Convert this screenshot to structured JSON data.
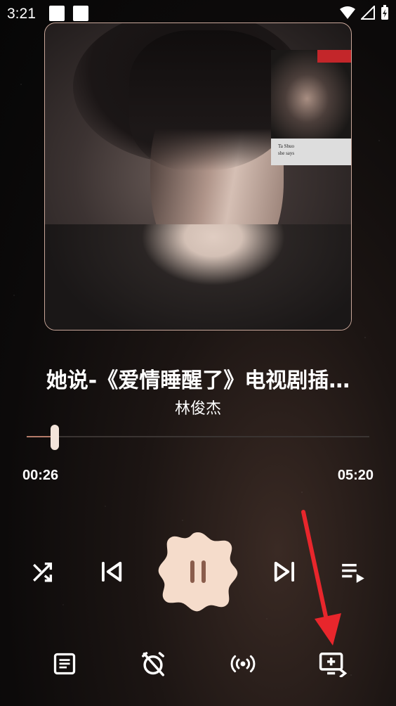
{
  "status_bar": {
    "time": "3:21"
  },
  "album": {
    "inset_caption_line1": "Ta Shuo",
    "inset_caption_line2": "she says"
  },
  "song": {
    "title": "她说-《爱情睡醒了》电视剧插…",
    "artist": "林俊杰"
  },
  "progress": {
    "current": "00:26",
    "total": "05:20",
    "fraction": 0.08125
  },
  "controls": [
    {
      "name": "shuffle-button",
      "icon": "shuffle-icon"
    },
    {
      "name": "previous-button",
      "icon": "skip-previous-icon"
    },
    {
      "name": "pause-button",
      "icon": "pause-icon"
    },
    {
      "name": "next-button",
      "icon": "skip-next-icon"
    },
    {
      "name": "playlist-button",
      "icon": "queue-music-icon"
    }
  ],
  "bottom_actions": [
    {
      "name": "lyrics-button",
      "icon": "lyrics-icon"
    },
    {
      "name": "sleep-timer-button",
      "icon": "alarm-off-icon"
    },
    {
      "name": "broadcast-button",
      "icon": "broadcast-icon"
    },
    {
      "name": "add-to-playlist-button",
      "icon": "add-to-queue-icon"
    }
  ],
  "colors": {
    "accent": "#b47b69",
    "pause_button_bg": "#f5dccb",
    "pause_icon": "#8a5d4c",
    "annotation_arrow": "#e8262c"
  }
}
